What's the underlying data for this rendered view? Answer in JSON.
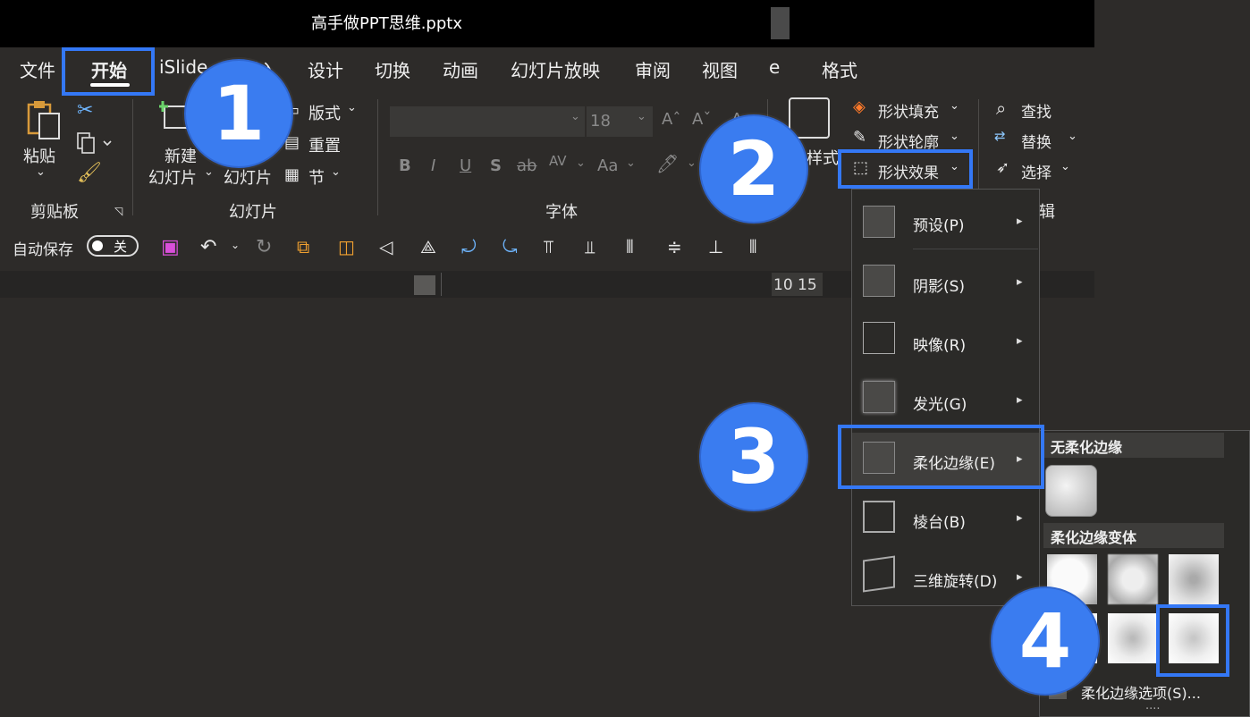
{
  "window": {
    "title": "高手做PPT思维.pptx"
  },
  "tabs": [
    "文件",
    "开始",
    "iSlide",
    "插入",
    "设计",
    "切换",
    "动画",
    "幻灯片放映",
    "审阅",
    "视图",
    "e",
    "格式"
  ],
  "ribbon": {
    "clipboard": {
      "paste": "粘贴",
      "group": "剪贴板"
    },
    "slides": {
      "new_line1": "新建",
      "new_line2": "幻灯片",
      "new2": "幻灯片",
      "layout": "版式",
      "reset": "重置",
      "section": "节",
      "group": "幻灯片"
    },
    "font": {
      "size": "18",
      "group": "字体",
      "bold": "B",
      "italic": "I",
      "underline": "U",
      "shadow": "S",
      "strike": "ab",
      "spacing": "AV",
      "case": "Aa",
      "grow": "A",
      "shrink": "A"
    },
    "drawing": {
      "styles": "样式",
      "fill": "形状填充",
      "outline": "形状轮廓",
      "effects": "形状效果"
    },
    "editing": {
      "find": "查找",
      "replace": "替换",
      "select": "选择",
      "group": "辑"
    }
  },
  "qat": {
    "autosave": "自动保存",
    "toggle": "关"
  },
  "ruler": {
    "text": "10 15"
  },
  "menu": {
    "items": [
      {
        "label": "预设(P)"
      },
      {
        "label": "阴影(S)"
      },
      {
        "label": "映像(R)"
      },
      {
        "label": "发光(G)"
      },
      {
        "label": "柔化边缘(E)"
      },
      {
        "label": "棱台(B)"
      },
      {
        "label": "三维旋转(D)"
      }
    ]
  },
  "submenu": {
    "none_header": "无柔化边缘",
    "variants_header": "柔化边缘变体",
    "options": "柔化边缘选项(S)...",
    "dots": "...."
  },
  "badges": [
    "1",
    "2",
    "3",
    "4"
  ],
  "colors": {
    "accent": "#3478f6",
    "badge": "#3a7cf0",
    "bg": "#2d2b29"
  }
}
